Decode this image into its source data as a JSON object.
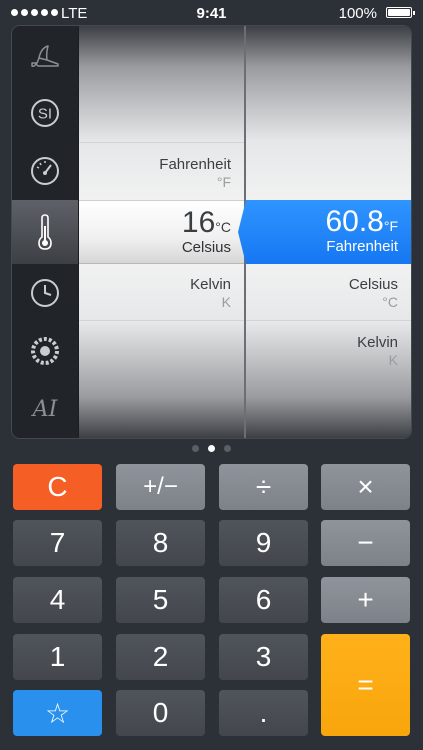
{
  "status": {
    "carrier": "LTE",
    "time": "9:41",
    "battery": "100%",
    "signal_bars": 5
  },
  "categories": [
    {
      "id": "shoe",
      "icon": "shoe-icon"
    },
    {
      "id": "si",
      "icon": "si-icon",
      "label": "SI"
    },
    {
      "id": "speed",
      "icon": "gauge-icon"
    },
    {
      "id": "temperature",
      "icon": "thermometer-icon",
      "active": true
    },
    {
      "id": "time",
      "icon": "clock-icon"
    },
    {
      "id": "tire",
      "icon": "tire-icon"
    },
    {
      "id": "typography",
      "icon": "typography-icon",
      "label": "AI"
    }
  ],
  "left_wheel": {
    "above": {
      "name": "Fahrenheit",
      "symbol": "°F"
    },
    "selected": {
      "value": "16",
      "symbol": "°C",
      "name": "Celsius"
    },
    "below": {
      "name": "Kelvin",
      "symbol": "K"
    }
  },
  "right_wheel": {
    "selected": {
      "value": "60.8",
      "symbol": "°F",
      "name": "Fahrenheit"
    },
    "below1": {
      "name": "Celsius",
      "symbol": "°C"
    },
    "below2": {
      "name": "Kelvin",
      "symbol": "K"
    }
  },
  "page_indicator": {
    "count": 3,
    "current": 1
  },
  "keypad": {
    "clear": "C",
    "plus_minus": "+/−",
    "divide": "÷",
    "multiply": "×",
    "seven": "7",
    "eight": "8",
    "nine": "9",
    "minus": "−",
    "four": "4",
    "five": "5",
    "six": "6",
    "plus": "+",
    "one": "1",
    "two": "2",
    "three": "3",
    "favorite": "☆",
    "zero": "0",
    "decimal": ".",
    "equals": "="
  },
  "colors": {
    "accent_blue": "#1a7ff5",
    "clear_orange": "#f55e24",
    "equals_yellow": "#ffad12",
    "favorite_blue": "#2a90ee"
  }
}
